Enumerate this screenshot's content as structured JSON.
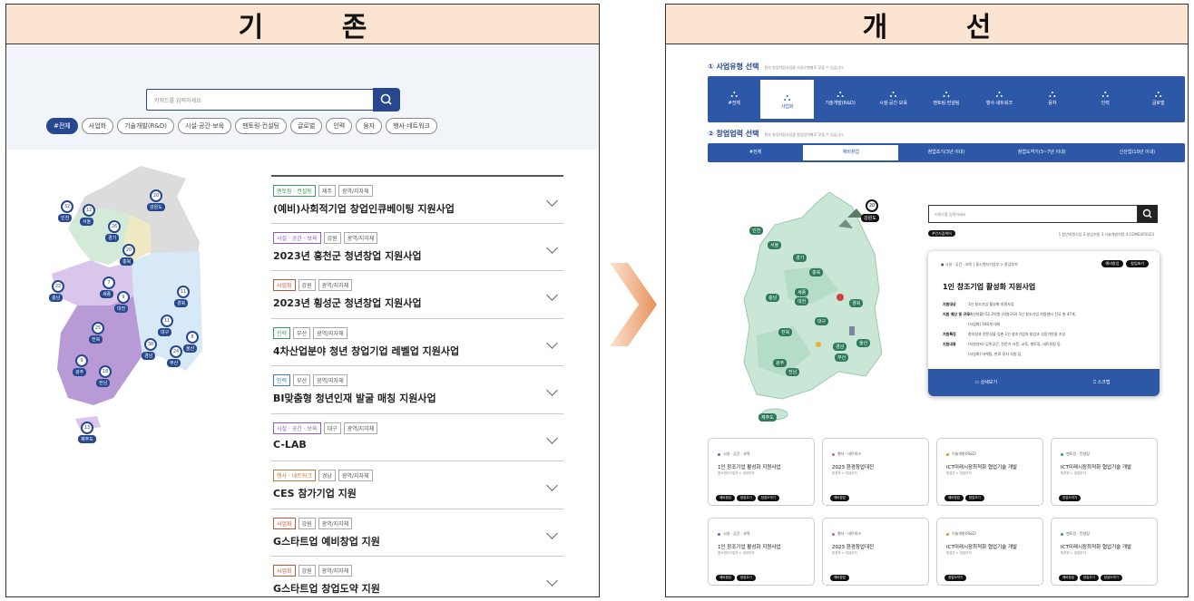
{
  "left": {
    "header": "기 존",
    "search_placeholder": "키워드를 입력하세요",
    "chips": [
      "#전체",
      "사업화",
      "기술개발(R&D)",
      "시설·공간·보육",
      "멘토링·컨설팅",
      "글로벌",
      "인력",
      "융자",
      "행사·네트워크"
    ],
    "map_pins": [
      {
        "n": "32",
        "name": "인천"
      },
      {
        "n": "12",
        "name": "서울"
      },
      {
        "n": "26",
        "name": "경기"
      },
      {
        "n": "20",
        "name": "강원도"
      },
      {
        "n": "20",
        "name": "충북"
      },
      {
        "n": "7",
        "name": "세종"
      },
      {
        "n": "22",
        "name": "충남"
      },
      {
        "n": "9",
        "name": "대전"
      },
      {
        "n": "11",
        "name": "경북"
      },
      {
        "n": "25",
        "name": "전북"
      },
      {
        "n": "11",
        "name": "대구"
      },
      {
        "n": "8",
        "name": "울산"
      },
      {
        "n": "38",
        "name": "경남"
      },
      {
        "n": "24",
        "name": "부산"
      },
      {
        "n": "9",
        "name": "광주"
      },
      {
        "n": "18",
        "name": "전남"
      },
      {
        "n": "13",
        "name": "제주도"
      }
    ],
    "items": [
      {
        "tags": [
          "멘토링 · 컨설팅",
          "제주",
          "광역/지자체"
        ],
        "title": "(예비)사회적기업 창업인큐베이팅 지원사업"
      },
      {
        "tags": [
          "시설 · 공간 · 보육",
          "강원",
          "광역/지자체"
        ],
        "title": "2023년 홍천군 청년창업 지원사업"
      },
      {
        "tags": [
          "사업화",
          "강원",
          "광역/지자체"
        ],
        "title": "2023년 횡성군 청년창업 지원사업"
      },
      {
        "tags": [
          "인력",
          "부산",
          "광역/지자체"
        ],
        "title": "4차산업분야 청년 창업기업 레벨업 지원사업"
      },
      {
        "tags": [
          "인력",
          "부산",
          "광역/지자체"
        ],
        "title": "BI맞춤형 청년인재 발굴 매칭 지원사업"
      },
      {
        "tags": [
          "시설 · 공간 · 보육",
          "대구",
          "광역/지자체"
        ],
        "title": "C-LAB"
      },
      {
        "tags": [
          "행사 · 네트워크",
          "경남",
          "광역/지자체"
        ],
        "title": "CES 참가기업 지원"
      },
      {
        "tags": [
          "사업화",
          "강원",
          "광역/지자체"
        ],
        "title": "G스타트업 예비창업 지원"
      },
      {
        "tags": [
          "사업화",
          "강원",
          "광역/지자체"
        ],
        "title": "G스타트업 창업도약 지원"
      }
    ]
  },
  "right": {
    "header": "개 선",
    "sec1_title": "① 사업유형 선택",
    "sec1_note": "원부 창업지원사업을 사업유형별로 찾을 수 있습니다",
    "categories": [
      "#전체",
      "사업화",
      "기술개발(R&D)",
      "시설·공간·보육",
      "멘토링·컨설팅",
      "행사·네트워크",
      "융자",
      "인력",
      "글로벌"
    ],
    "sec2_title": "② 창업업력 선택",
    "sec2_note": "원부 창업지원사업을 창업업력별로 찾을 수 있습니다",
    "stages": [
      "#전체",
      "예비창업",
      "창업초기(3년 이내)",
      "창업도약기(3~7년 이내)",
      "신산업(10년 이내)"
    ],
    "search_placeholder": "키워드를 입력하세요",
    "hot_tag": "#인기검색어",
    "hot_keywords": "1.청년지원사업  2.창업지원  3.기술개발지원  4.COMEUP2023",
    "map_region_badge": "강원도",
    "map_region_count": "20",
    "map_regions": [
      "인천",
      "서울",
      "경기",
      "충북",
      "충남",
      "세종",
      "대전",
      "경북",
      "대구",
      "전북",
      "경남",
      "울산",
      "부산",
      "광주",
      "전남",
      "제주도"
    ],
    "card": {
      "category": "● 시설 · 공간 · 보육   |   중소벤처기업부 > 창업부처",
      "badges": [
        "예비창업",
        "창업초기"
      ],
      "title": "1인 창조기업 활성화 지원사업",
      "rows": [
        {
          "k": "지원대상",
          "v": "1인 창조기업 활성화 지원사업"
        },
        {
          "k": "지원 예산 및 규모",
          "v": "(예산현황) 51.2억원 (지원규모) 1인 창조기업 지원센터 전국 총 47개,"
        },
        {
          "k": "",
          "v": "(사업화) 160개 내외"
        },
        {
          "k": "지원특징",
          "v": "창의성과 전문성을 갖춘 1인 창조기업의 창업과 성장기반을 조성"
        },
        {
          "k": "지원내용",
          "v": "(지원센터) 입주공간, 전문가 자문, 교육, 멘토링, 네트워킹 등"
        },
        {
          "k": "",
          "v": "(사업화) 마케팅, 판로·투자 지원 등"
        }
      ],
      "btn_detail": "상세보기",
      "btn_scrap": "스크랩"
    },
    "grid": [
      {
        "cat": "시설 · 공간 · 보육",
        "color": "#7a5cc4",
        "title": "1인 창조기업 활성화 지원사업",
        "sub": "중소벤처기업부 > 창업부처",
        "badges": [
          "예비창업",
          "창업초기",
          "창업도약기"
        ]
      },
      {
        "cat": "행사 · 네트워크",
        "color": "#c45cb5",
        "title": "2023 환경창업대전",
        "sub": "환경부 > 창업부처",
        "badges": [
          "예비창업"
        ]
      },
      {
        "cat": "기술개발(R&D)",
        "color": "#e8902a",
        "title": "ICT미래시장최적화 협업기술 개발",
        "sub": "환경부 > 창업부처",
        "badges": [
          "예비창업",
          "창업초기"
        ]
      },
      {
        "cat": "멘토링 · 컨설팅",
        "color": "#3b9a5a",
        "title": "ICT미래시장최적화 협업기술 개발",
        "sub": "특허청 > 창업부처",
        "badges": [
          "창업도약기"
        ]
      },
      {
        "cat": "시설 · 공간 · 보육",
        "color": "#7a5cc4",
        "title": "1인 창조기업 활성화 지원사업",
        "sub": "중소벤처기업부 > 창업부처",
        "badges": [
          "예비창업",
          "창업초기"
        ]
      },
      {
        "cat": "행사 · 네트워크",
        "color": "#c45cb5",
        "title": "2023 환경창업대전",
        "sub": "환경부 > 창업부처",
        "badges": [
          "예비창업"
        ]
      },
      {
        "cat": "기술개발(R&D)",
        "color": "#e8902a",
        "title": "ICT미래시장최적화 협업기술 개발",
        "sub": "환경부 > 창업부처",
        "badges": [
          "창업도약기"
        ]
      },
      {
        "cat": "멘토링 · 컨설팅",
        "color": "#3b9a5a",
        "title": "ICT미래시장최적화 협업기술 개발",
        "sub": "특허청 > 창업부처",
        "badges": [
          "예비창업",
          "창업초기",
          "창업도약기"
        ]
      }
    ]
  }
}
